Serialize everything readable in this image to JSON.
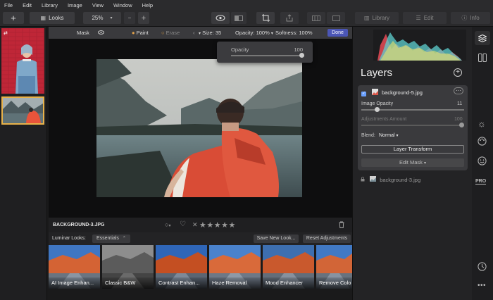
{
  "menu": [
    "File",
    "Edit",
    "Library",
    "Image",
    "View",
    "Window",
    "Help"
  ],
  "toolbar": {
    "looks_label": "Looks",
    "zoom": "25%",
    "zoom_minus": "−",
    "zoom_plus": "+"
  },
  "right_tabs": {
    "library": "Library",
    "edit": "Edit",
    "info": "Info"
  },
  "maskbar": {
    "mask": "Mask",
    "paint": "Paint",
    "erase": "Erase",
    "size": "Size: 35",
    "opacity": "Opacity: 100%",
    "softness": "Softness: 100%",
    "done": "Done"
  },
  "popup": {
    "label": "Opacity",
    "value": "100",
    "level_percent": 100
  },
  "image_info": {
    "filename": "BACKGROUND-3.JPG",
    "stars": "★★★★★",
    "reject": "✕"
  },
  "looks": {
    "label": "Luminar Looks:",
    "category": "Essentials",
    "save_button": "Save New Look...",
    "reset_button": "Reset Adjustments",
    "items": [
      {
        "name": "AI Image Enhan..."
      },
      {
        "name": "Classic B&W"
      },
      {
        "name": "Contrast Enhan..."
      },
      {
        "name": "Haze Removal"
      },
      {
        "name": "Mood Enhancer"
      },
      {
        "name": "Remove Colo"
      }
    ]
  },
  "layers": {
    "title": "Layers",
    "active_layer": {
      "name": "background-5.jpg",
      "image_opacity_label": "Image Opacity",
      "image_opacity_value": "11",
      "image_opacity_level": 11,
      "adjustments_label": "Adjustments Amount",
      "adjustments_value": "100",
      "adjustments_level": 100,
      "blend_label": "Blend:",
      "blend_value": "Normal",
      "layer_transform": "Layer Transform",
      "edit_mask": "Edit Mask"
    },
    "base_layer": {
      "name": "background-3.jpg"
    }
  },
  "colors": {
    "accent": "#4b56b6",
    "highlight_border": "#e8b24a"
  }
}
